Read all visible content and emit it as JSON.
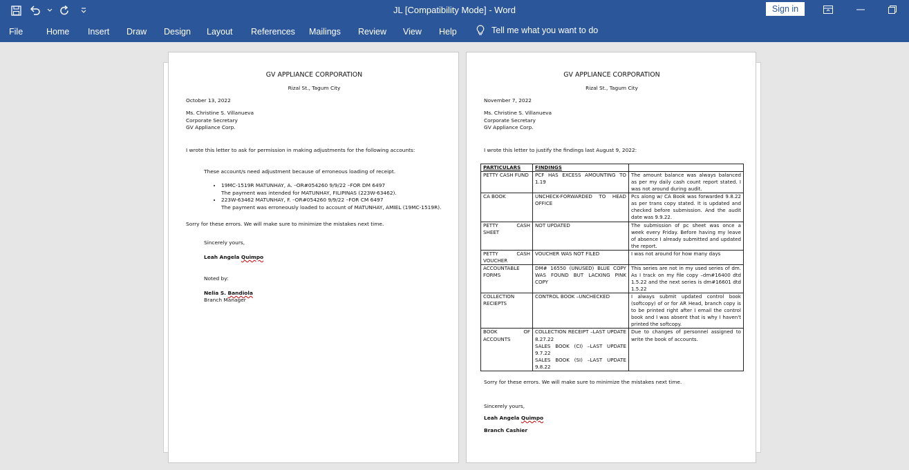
{
  "app": {
    "title": "JL [Compatibility Mode]  -  Word",
    "signin_label": "Sign in"
  },
  "ribbon": {
    "tabs": [
      "File",
      "Home",
      "Insert",
      "Draw",
      "Design",
      "Layout",
      "References",
      "Mailings",
      "Review",
      "View",
      "Help"
    ],
    "tell_me": "Tell me what you want to do"
  },
  "icons": {
    "save": "save-icon",
    "undo": "undo-icon",
    "redo": "redo-icon",
    "customize": "customize-qat-icon",
    "ribbon_display": "ribbon-display-options-icon",
    "minimize": "minimize-icon",
    "restore": "restore-icon",
    "lightbulb": "lightbulb-icon"
  },
  "colors": {
    "accent": "#2b579a",
    "canvas": "#e6e6e6"
  },
  "page1": {
    "company": "GV APPLIANCE CORPORATION",
    "address": "Rizal St., Tagum City",
    "date": "October 13, 2022",
    "recipient_name": "Ms. Christine S. Villanueva",
    "recipient_title": "Corporate Secretary",
    "recipient_company": "GV Appliance Corp.",
    "intro": "I wrote this letter to ask for permission in making adjustments for the following accounts:",
    "reason": "These account/s need adjustment because of erroneous loading of receipt.",
    "items": [
      {
        "line1": "19MC-1519R MATUNHAY, A. –OR#054260 9/9/22 –FOR DM 6497",
        "line2": "The payment was intended for MATUNHAY, FILIPINAS (223W-63462)."
      },
      {
        "line1": "223W-63462 MATUNHAY, F. –OR#054260 9/9/22 –FOR CM 6497",
        "line2": "The payment was erroneously loaded to account of MATUNHAY, AMIEL (19MC-1519R)."
      }
    ],
    "closing": "Sorry for these errors. We will make sure to minimize the mistakes next time.",
    "salutation": "Sincerely yours,",
    "signer_first": "Leah Angela ",
    "signer_last": "Quimpo",
    "noted_by": "Noted by:",
    "noter_first": "Nelia S. ",
    "noter_last": "Bandiola",
    "noter_title": "Branch Manager"
  },
  "page2": {
    "company": "GV APPLIANCE CORPORATION",
    "address": "Rizal St., Tagum City",
    "date": "November 7, 2022",
    "recipient_name": "Ms. Christine S. Villanueva",
    "recipient_title": "Corporate Secretary",
    "recipient_company": "GV Appliance Corp.",
    "intro": "I wrote this letter to justify the findings last August 9, 2022:",
    "table": {
      "headers": [
        "PARTICULARS",
        "FINDINGS",
        ""
      ],
      "rows": [
        [
          "PETTY CASH FUND",
          "PCF HAS EXCESS AMOUNTING TO 1.19",
          "The amount balance was always balanced as per my daily cash count report stated. I was not around during audit."
        ],
        [
          "CA BOOK",
          "UNCHECK-FORWARDED TO HEAD OFFICE",
          "Pcs along w/ CA Book was forwarded 9.8.22 as per trans copy stated. It is updated and checked before submission. And the audit date was 9.9.22."
        ],
        [
          "PETTY CASH SHEET",
          "NOT UPDATED",
          "The submission of pc sheet was once a week every Friday. Before having my leave of absence I already submitted and updated the report."
        ],
        [
          "PETTY CASH VOUCHER",
          "VOUCHER WAS NOT FILED",
          "I was not around for how many days"
        ],
        [
          "ACCOUNTABLE FORMS",
          "DM# 16550 (UNUSED) BLUE COPY WAS FOUND BUT LACKING PINK COPY",
          "This series are not in my used series of dm. As I track on my file copy –dm#16400 dtd 1.5.22 and the next series is dm#16601 dtd 1.5.22"
        ],
        [
          "COLLECTION RECIEPTS",
          "CONTROL BOOK –UNCHECKED",
          "I always submit updated control book (softcopy) of or for AR Head, branch copy is to be printed right after I email the control book and I was absent that is why I haven't printed the softcopy."
        ],
        [
          "BOOK OF ACCOUNTS",
          "COLLECTION RECEIPT –LAST UPDATE 8.27.22\nSALES BOOK (CI) –LAST UPDATE 9.7.22\nSALES BOOK (SI) –LAST UPDATE 9.8.22",
          "Due to changes of personnel assigned to write the book of accounts."
        ]
      ]
    },
    "closing": "Sorry for these errors. We will make sure to minimize the mistakes next time.",
    "salutation": "Sincerely yours,",
    "signer_first": "Leah Angela ",
    "signer_last": "Quimpo",
    "signer_title": "Branch Cashier"
  }
}
